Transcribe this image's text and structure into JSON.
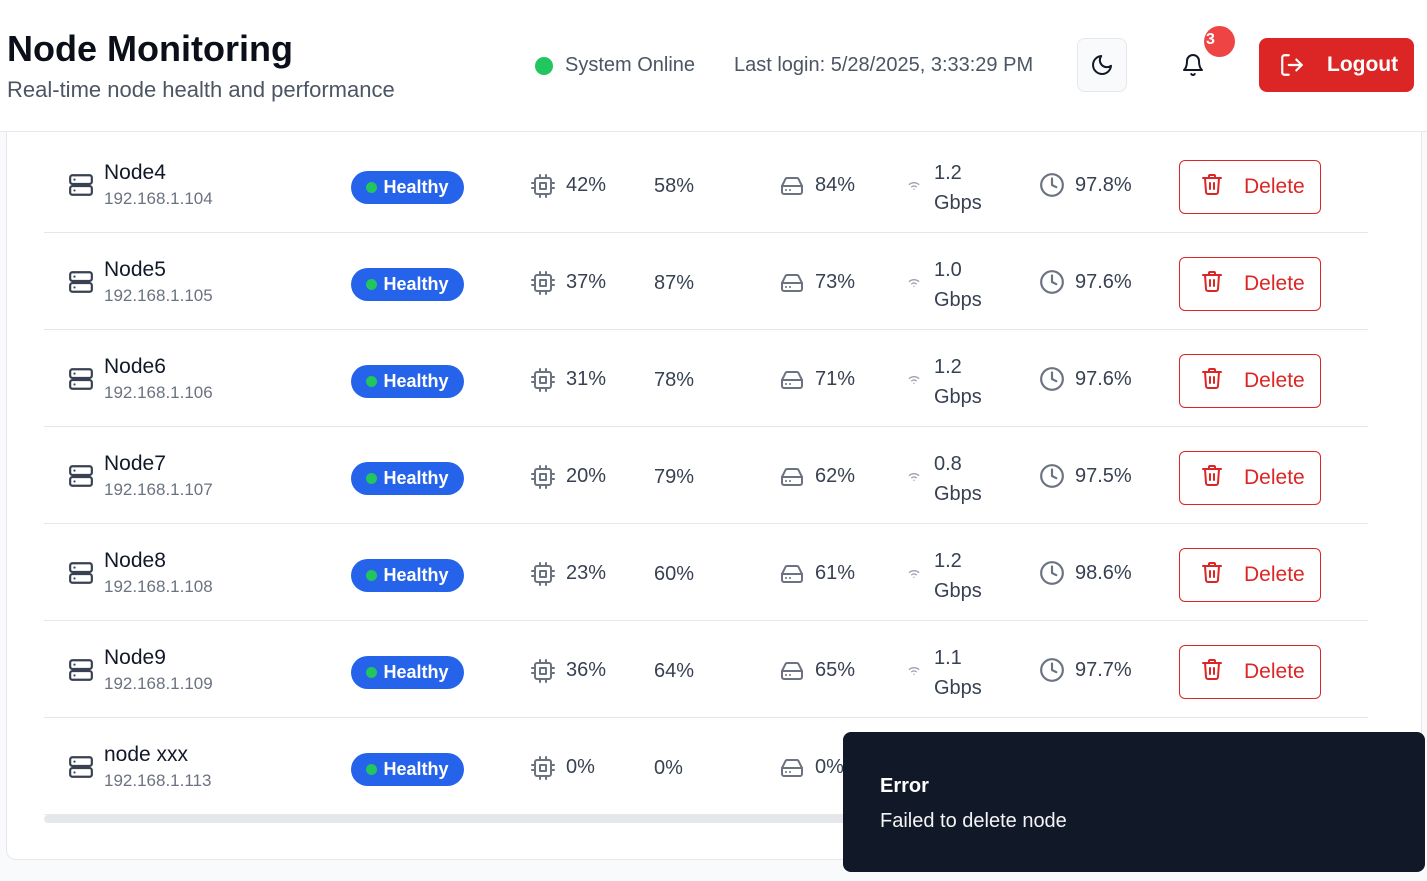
{
  "header": {
    "title": "Node Monitoring",
    "subtitle": "Real-time node health and performance",
    "status_text": "System Online",
    "last_login": "Last login: 5/28/2025, 3:33:29 PM",
    "notification_count": "3",
    "logout_label": "Logout",
    "icons": {
      "theme": "moon-icon",
      "notifications": "bell-icon",
      "logout": "logout-icon"
    }
  },
  "colors": {
    "online": "#22c55e",
    "status_badge": "#2563eb",
    "danger": "#dc2626",
    "toast_bg": "#111827"
  },
  "nodes": [
    {
      "name": "Node4",
      "ip": "192.168.1.104",
      "status": "Healthy",
      "cpu": "42%",
      "memory": "58%",
      "disk": "84%",
      "network": "1.2 Gbps",
      "uptime": "97.8%",
      "delete_label": "Delete"
    },
    {
      "name": "Node5",
      "ip": "192.168.1.105",
      "status": "Healthy",
      "cpu": "37%",
      "memory": "87%",
      "disk": "73%",
      "network": "1.0 Gbps",
      "uptime": "97.6%",
      "delete_label": "Delete"
    },
    {
      "name": "Node6",
      "ip": "192.168.1.106",
      "status": "Healthy",
      "cpu": "31%",
      "memory": "78%",
      "disk": "71%",
      "network": "1.2 Gbps",
      "uptime": "97.6%",
      "delete_label": "Delete"
    },
    {
      "name": "Node7",
      "ip": "192.168.1.107",
      "status": "Healthy",
      "cpu": "20%",
      "memory": "79%",
      "disk": "62%",
      "network": "0.8 Gbps",
      "uptime": "97.5%",
      "delete_label": "Delete"
    },
    {
      "name": "Node8",
      "ip": "192.168.1.108",
      "status": "Healthy",
      "cpu": "23%",
      "memory": "60%",
      "disk": "61%",
      "network": "1.2 Gbps",
      "uptime": "98.6%",
      "delete_label": "Delete"
    },
    {
      "name": "Node9",
      "ip": "192.168.1.109",
      "status": "Healthy",
      "cpu": "36%",
      "memory": "64%",
      "disk": "65%",
      "network": "1.1 Gbps",
      "uptime": "97.7%",
      "delete_label": "Delete"
    },
    {
      "name": "node xxx",
      "ip": "192.168.1.113",
      "status": "Healthy",
      "cpu": "0%",
      "memory": "0%",
      "disk": "0%",
      "network": "",
      "uptime": "",
      "delete_label": ""
    }
  ],
  "toast": {
    "title": "Error",
    "message": "Failed to delete node"
  }
}
